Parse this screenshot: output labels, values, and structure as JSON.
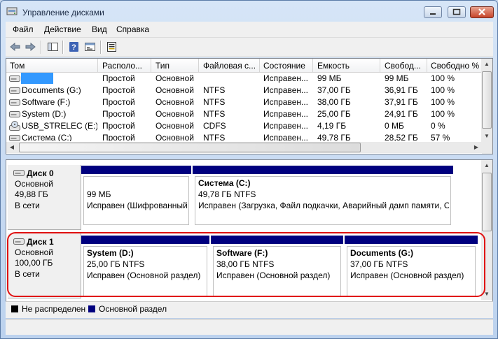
{
  "window": {
    "title": "Управление дисками"
  },
  "menu": [
    "Файл",
    "Действие",
    "Вид",
    "Справка"
  ],
  "colors": {
    "unallocated": "#000000",
    "primary_partition": "#00007f",
    "highlight": "#e01010"
  },
  "volumes": {
    "columns": [
      "Том",
      "Располо...",
      "Тип",
      "Файловая с...",
      "Состояние",
      "Емкость",
      "Свобод...",
      "Свободно %"
    ],
    "rows": [
      [
        "",
        "Простой",
        "Основной",
        "",
        "Исправен...",
        "99 МБ",
        "99 МБ",
        "100 %"
      ],
      [
        "Documents (G:)",
        "Простой",
        "Основной",
        "NTFS",
        "Исправен...",
        "37,00 ГБ",
        "36,91 ГБ",
        "100 %"
      ],
      [
        "Software (F:)",
        "Простой",
        "Основной",
        "NTFS",
        "Исправен...",
        "38,00 ГБ",
        "37,91 ГБ",
        "100 %"
      ],
      [
        "System (D:)",
        "Простой",
        "Основной",
        "NTFS",
        "Исправен...",
        "25,00 ГБ",
        "24,91 ГБ",
        "100 %"
      ],
      [
        "USB_STRELEC (E:)",
        "Простой",
        "Основной",
        "CDFS",
        "Исправен...",
        "4,19 ГБ",
        "0 МБ",
        "0 %"
      ],
      [
        "Система (C:)",
        "Простой",
        "Основной",
        "NTFS",
        "Исправен...",
        "49,78 ГБ",
        "28,52 ГБ",
        "57 %"
      ]
    ]
  },
  "disks": [
    {
      "name": "Диск 0",
      "type": "Основной",
      "size": "49,88 ГБ",
      "status": "В сети",
      "partitions": [
        {
          "name": "",
          "size": "99 МБ",
          "status": "Исправен (Шифрованный"
        },
        {
          "name": "Система  (C:)",
          "size": "49,78 ГБ NTFS",
          "status": "Исправен (Загрузка, Файл подкачки, Аварийный дамп памяти, О"
        }
      ]
    },
    {
      "name": "Диск 1",
      "type": "Основной",
      "size": "100,00 ГБ",
      "status": "В сети",
      "partitions": [
        {
          "name": "System  (D:)",
          "size": "25,00 ГБ NTFS",
          "status": "Исправен (Основной раздел)"
        },
        {
          "name": "Software  (F:)",
          "size": "38,00 ГБ NTFS",
          "status": "Исправен (Основной раздел)"
        },
        {
          "name": "Documents  (G:)",
          "size": "37,00 ГБ NTFS",
          "status": "Исправен (Основной раздел)"
        }
      ]
    }
  ],
  "legend": {
    "unallocated": "Не распределен",
    "primary": "Основной раздел"
  }
}
